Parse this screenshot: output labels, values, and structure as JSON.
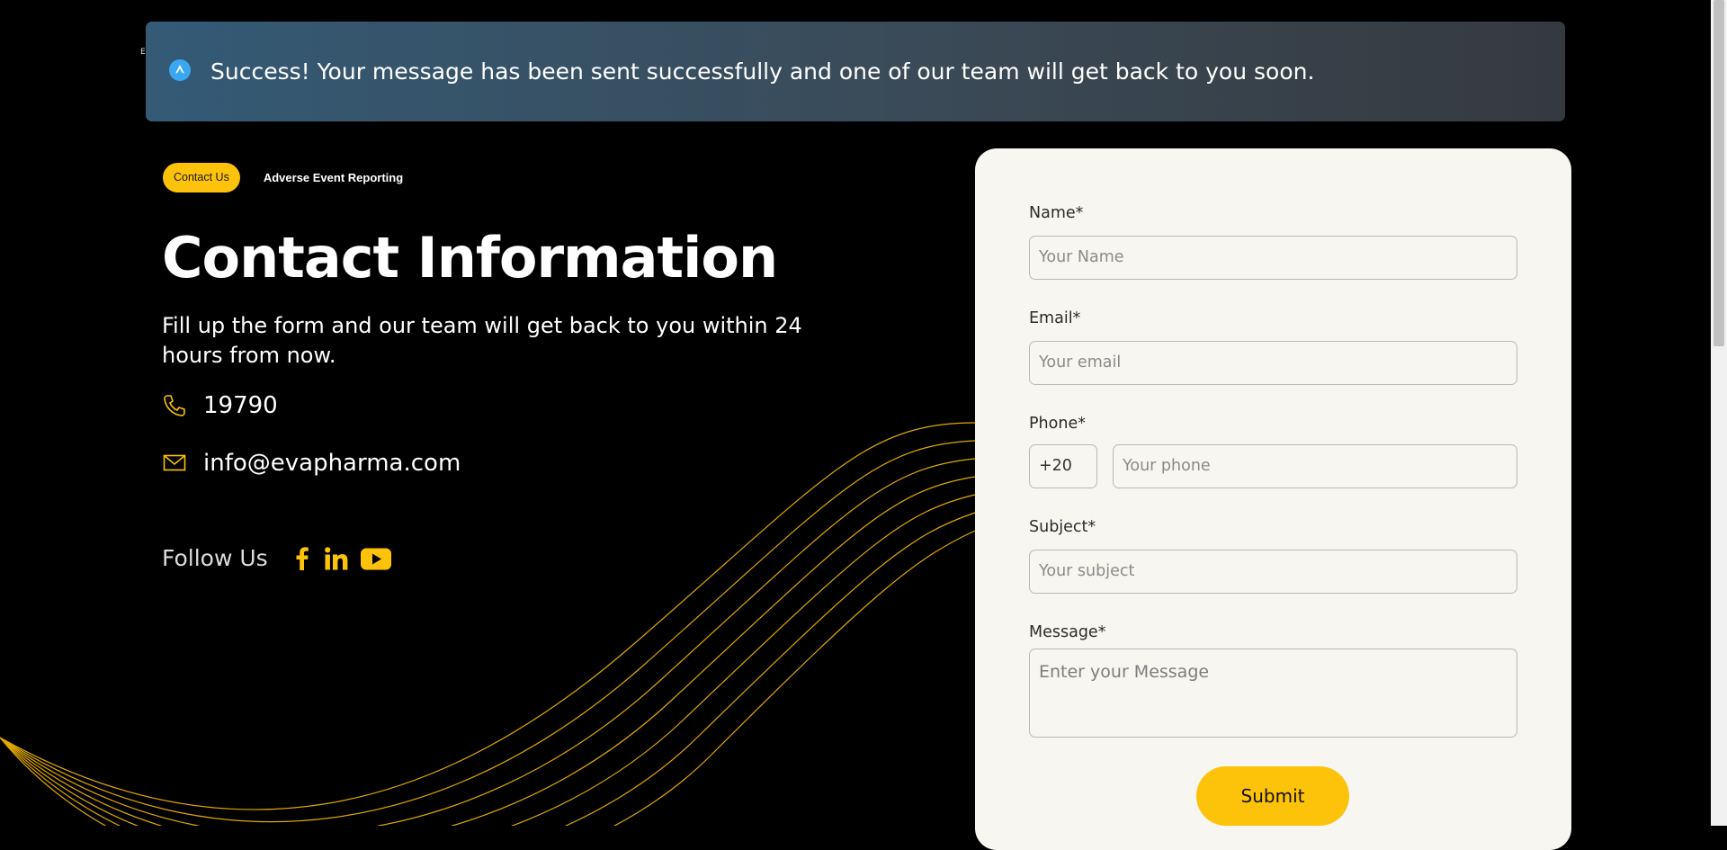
{
  "alert": {
    "message": "Success! Your message has been sent successfully and one of our team will get back to you soon.",
    "icon": "info-icon"
  },
  "tabs": {
    "active": "Contact Us",
    "other": "Adverse Event Reporting"
  },
  "contact": {
    "title": "Contact Information",
    "subtitle": "Fill up the form and our team will get back to you within 24 hours from now.",
    "phone": "19790",
    "email": "info@evapharma.com"
  },
  "follow": {
    "label": "Follow Us",
    "networks": [
      "facebook-icon",
      "linkedin-icon",
      "youtube-icon"
    ]
  },
  "form": {
    "name_label": "Name*",
    "name_placeholder": "Your Name",
    "email_label": "Email*",
    "email_placeholder": "Your email",
    "phone_label": "Phone*",
    "phone_code": "+20",
    "phone_placeholder": "Your phone",
    "subject_label": "Subject*",
    "subject_placeholder": "Your subject",
    "message_label": "Message*",
    "message_placeholder": "Enter your Message",
    "submit_label": "Submit"
  },
  "colors": {
    "accent": "#fdc20a",
    "background": "#000000",
    "card": "#f7f6f1",
    "alert_start": "#345a76",
    "alert_end": "#353a3f"
  }
}
